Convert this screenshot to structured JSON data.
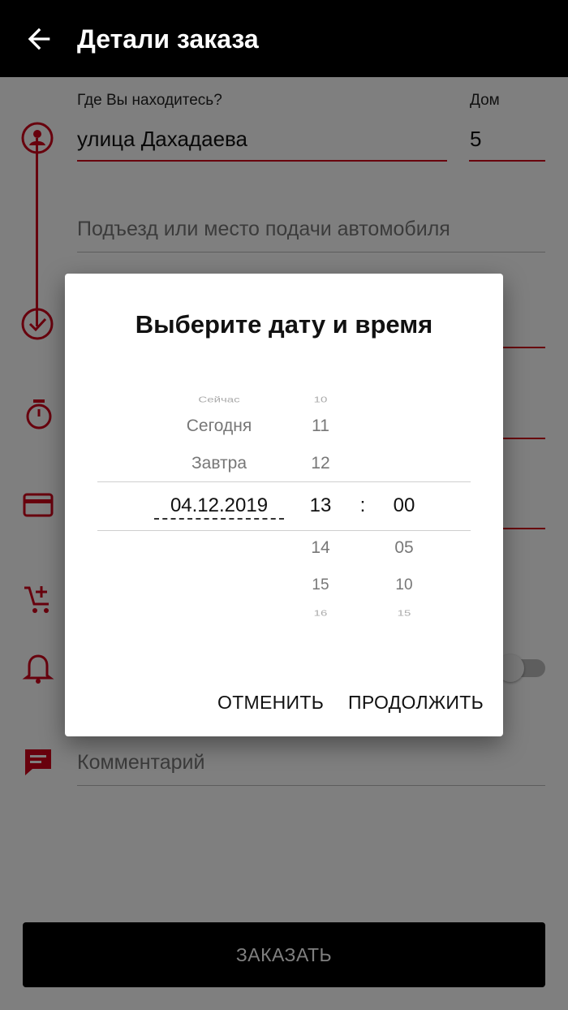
{
  "appbar": {
    "title": "Детали заказа",
    "back_icon": "arrow-back-icon"
  },
  "form": {
    "location_label": "Где Вы находитесь?",
    "location_value": "улица Дахадаева",
    "house_label": "Дом",
    "house_value": "5",
    "entrance_placeholder": "Подъезд или место подачи автомобиля",
    "comment_placeholder": "Комментарий",
    "toggle_on": false,
    "icons": [
      "person-pin-icon",
      "check-circle-icon",
      "timer-icon",
      "credit-card-icon",
      "add-cart-icon",
      "bell-icon",
      "comment-icon"
    ]
  },
  "order_button": {
    "label": "ЗАКАЗАТЬ"
  },
  "dialog": {
    "title": "Выберите дату и время",
    "date_column": {
      "above": [
        "Сейчас",
        "Сегодня",
        "Завтра"
      ],
      "selected": "04.12.2019"
    },
    "hour_column": {
      "above": [
        "10",
        "11",
        "12"
      ],
      "selected": "13",
      "below": [
        "14",
        "15",
        "16"
      ]
    },
    "separator": ":",
    "minute_column": {
      "selected": "00",
      "below": [
        "05",
        "10",
        "15"
      ]
    },
    "cancel_label": "ОТМЕНИТЬ",
    "continue_label": "ПРОДОЛЖИТЬ"
  },
  "colors": {
    "accent": "#d0021b",
    "appbar": "#000000"
  }
}
